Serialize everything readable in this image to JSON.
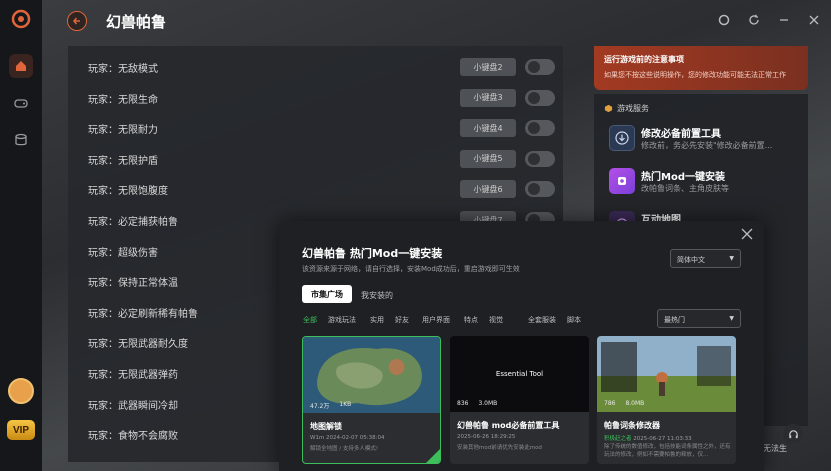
{
  "app": {
    "title": "幻兽帕鲁",
    "vip": "VIP"
  },
  "cheats": [
    {
      "label": "玩家：无敌模式",
      "key": "小键盘2"
    },
    {
      "label": "玩家：无限生命",
      "key": "小键盘3"
    },
    {
      "label": "玩家：无限耐力",
      "key": "小键盘4"
    },
    {
      "label": "玩家：无限护盾",
      "key": "小键盘5"
    },
    {
      "label": "玩家：无限饱腹度",
      "key": "小键盘6"
    },
    {
      "label": "玩家：必定捕获帕鲁",
      "key": "小键盘7"
    },
    {
      "label": "玩家：超级伤害",
      "key": ""
    },
    {
      "label": "玩家：保持正常体温",
      "key": ""
    },
    {
      "label": "玩家：必定刷新稀有帕鲁",
      "key": ""
    },
    {
      "label": "玩家：无限武器耐久度",
      "key": ""
    },
    {
      "label": "玩家：无限武器弹药",
      "key": ""
    },
    {
      "label": "玩家：武器瞬间冷却",
      "key": ""
    },
    {
      "label": "玩家：食物不会腐败",
      "key": ""
    }
  ],
  "notice": {
    "title": "运行游戏前的注意事项",
    "desc": "如果您不按这些说明操作，您的修改功能可能无法正常工作"
  },
  "services": {
    "heading": "游戏服务",
    "items": [
      {
        "title": "修改必备前置工具",
        "desc": "修改前，务必先安装\"修改必备前置..."
      },
      {
        "title": "热门Mod一键安装",
        "desc": "改帕鲁词条、主角皮肤等"
      },
      {
        "title": "互动地图",
        "desc": ""
      }
    ]
  },
  "help": {
    "text": "无法生"
  },
  "modal": {
    "title": "幻兽帕鲁 热门Mod一键安装",
    "subtitle": "该资源来源于网络，请自行选择，安装Mod成功后，重启游戏即可生效",
    "language": "简体中文",
    "tabs": [
      "市集广场",
      "我安装的"
    ],
    "filters": [
      "全部",
      "游戏玩法",
      "实用",
      "好友",
      "用户界面",
      "特点",
      "视觉",
      "全套服装",
      "脚本"
    ],
    "sort": "最热门",
    "cards": [
      {
        "downloads": "47.2万",
        "size": "1KB",
        "name": "地图解锁",
        "author": "W1m",
        "date": "2024-02-07 05:38:04",
        "desc": "解锁全地图 / 支持多人模式!"
      },
      {
        "downloads": "836",
        "size": "3.0MB",
        "name": "幻兽帕鲁 mod必备前置工具",
        "author": "",
        "date": "2025-06-26 18:29:25",
        "desc": "安装其他mod前请优先安装此mod",
        "thumb_text": "Essential Tool"
      },
      {
        "downloads": "786",
        "size": "8.0MB",
        "name": "帕鲁词条修改器",
        "author": "积极赶之者",
        "date": "2025-06-27 11:03:33",
        "desc": "除了传统的数值修改，包括技能词条属性之外，还有玩法的修改，例如不需要帕鲁的释放，仅..."
      }
    ]
  },
  "colors": {
    "accent": "#e0653a",
    "green": "#3cbf5a"
  }
}
